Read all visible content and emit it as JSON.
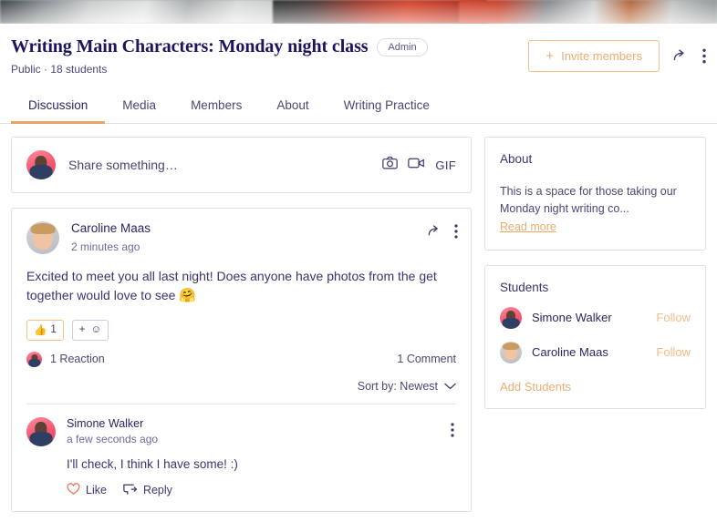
{
  "banner": {
    "alt": "group cover photo"
  },
  "header": {
    "title": "Writing Main Characters: Monday night class",
    "badge": "Admin",
    "meta": "Public · 18 students",
    "invite_label": "Invite members",
    "invite_plus": "+",
    "share_icon": "share-icon",
    "more_icon": "more-vertical-icon"
  },
  "tabs": [
    {
      "label": "Discussion",
      "active": true
    },
    {
      "label": "Media",
      "active": false
    },
    {
      "label": "Members",
      "active": false
    },
    {
      "label": "About",
      "active": false
    },
    {
      "label": "Writing Practice",
      "active": false
    }
  ],
  "composer": {
    "placeholder": "Share something…",
    "camera_icon": "camera-icon",
    "video_icon": "video-icon",
    "gif_label": "GIF"
  },
  "post": {
    "author": "Caroline Maas",
    "time": "2 minutes ago",
    "body": "Excited to meet you all last night! Does anyone have photos from the get together would love to see ",
    "body_emoji": "🤗",
    "reaction_emoji": "👍",
    "reaction_count": "1",
    "add_reaction_plus": "+",
    "add_reaction_emoji": "☺",
    "reactions_label": "1 Reaction",
    "comments_label": "1 Comment",
    "sort_label": "Sort by: Newest"
  },
  "comment": {
    "author": "Simone Walker",
    "time": "a few seconds ago",
    "text": "I'll check, I think I have some! :)",
    "like_label": "Like",
    "reply_label": "Reply"
  },
  "about": {
    "title": "About",
    "text": "This is a space for those taking our Monday night writing co...",
    "read_more": "Read more"
  },
  "students": {
    "title": "Students",
    "list": [
      {
        "name": "Simone Walker",
        "action": "Follow"
      },
      {
        "name": "Caroline Maas",
        "action": "Follow"
      }
    ],
    "add_label": "Add Students"
  },
  "colors": {
    "accent_orange": "#efab6a",
    "title_navy": "#1b1560",
    "text_purple": "#4b4775",
    "card_border": "#e0dcee"
  }
}
